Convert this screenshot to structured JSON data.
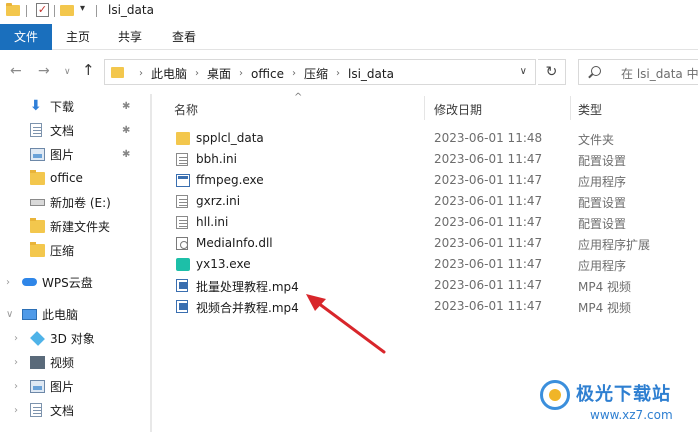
{
  "window": {
    "title": "lsi_data"
  },
  "ribbon": {
    "tabs": [
      "文件",
      "主页",
      "共享",
      "查看"
    ]
  },
  "address": {
    "crumbs": [
      "此电脑",
      "桌面",
      "office",
      "压缩",
      "lsi_data"
    ]
  },
  "search": {
    "placeholder": "在 lsi_data 中搜"
  },
  "sidebar": {
    "items": [
      {
        "label": "下载",
        "icon": "download-icon",
        "pinned": true
      },
      {
        "label": "文档",
        "icon": "document-icon",
        "pinned": true
      },
      {
        "label": "图片",
        "icon": "picture-icon",
        "pinned": true
      },
      {
        "label": "office",
        "icon": "folder-icon",
        "pinned": false
      },
      {
        "label": "新加卷 (E:)",
        "icon": "drive-icon",
        "pinned": false
      },
      {
        "label": "新建文件夹",
        "icon": "folder-icon",
        "pinned": false
      },
      {
        "label": "压缩",
        "icon": "folder-icon",
        "pinned": false
      },
      {
        "label": "WPS云盘",
        "icon": "cloud-icon",
        "pinned": false
      },
      {
        "label": "此电脑",
        "icon": "computer-icon",
        "pinned": false
      },
      {
        "label": "3D 对象",
        "icon": "3d-objects-icon",
        "pinned": false
      },
      {
        "label": "视频",
        "icon": "video-icon",
        "pinned": false
      },
      {
        "label": "图片",
        "icon": "picture-icon",
        "pinned": false
      },
      {
        "label": "文档",
        "icon": "document-icon",
        "pinned": false
      }
    ]
  },
  "columns": {
    "name": "名称",
    "date": "修改日期",
    "type": "类型"
  },
  "files": [
    {
      "name": "spplcl_data",
      "date": "2023-06-01 11:48",
      "type": "文件夹",
      "icon": "folder-icon"
    },
    {
      "name": "bbh.ini",
      "date": "2023-06-01 11:47",
      "type": "配置设置",
      "icon": "ini-file-icon"
    },
    {
      "name": "ffmpeg.exe",
      "date": "2023-06-01 11:47",
      "type": "应用程序",
      "icon": "exe-file-icon"
    },
    {
      "name": "gxrz.ini",
      "date": "2023-06-01 11:47",
      "type": "配置设置",
      "icon": "ini-file-icon"
    },
    {
      "name": "hll.ini",
      "date": "2023-06-01 11:47",
      "type": "配置设置",
      "icon": "ini-file-icon"
    },
    {
      "name": "MediaInfo.dll",
      "date": "2023-06-01 11:47",
      "type": "应用程序扩展",
      "icon": "dll-file-icon"
    },
    {
      "name": "yx13.exe",
      "date": "2023-06-01 11:47",
      "type": "应用程序",
      "icon": "app-exe-icon"
    },
    {
      "name": "批量处理教程.mp4",
      "date": "2023-06-01 11:47",
      "type": "MP4 视频",
      "icon": "video-file-icon"
    },
    {
      "name": "视频合并教程.mp4",
      "date": "2023-06-01 11:47",
      "type": "MP4 视频",
      "icon": "video-file-icon"
    }
  ],
  "watermark": {
    "title": "极光下载站",
    "url": "www.xz7.com"
  },
  "colors": {
    "accent": "#1a6fbd",
    "folder": "#f3c74d",
    "annotation": "#d8262b"
  }
}
